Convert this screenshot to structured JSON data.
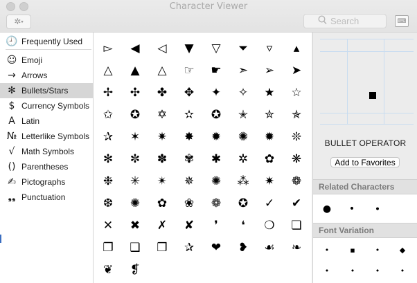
{
  "window": {
    "title": "Character Viewer"
  },
  "toolbar": {
    "action_glyph": "✲",
    "search_placeholder": "Search",
    "keyboard_glyph": "⌨"
  },
  "sidebar": {
    "items": [
      {
        "icon": "🕘",
        "icon_name": "clock-icon",
        "label": "Frequently Used"
      },
      {
        "icon": "☺",
        "icon_name": "smiley-icon",
        "label": "Emoji"
      },
      {
        "icon": "→",
        "icon_name": "arrow-right-icon",
        "label": "Arrows"
      },
      {
        "icon": "✻",
        "icon_name": "asterisk-star-icon",
        "label": "Bullets/Stars",
        "selected": true
      },
      {
        "icon": "$",
        "icon_name": "dollar-icon",
        "label": "Currency Symbols"
      },
      {
        "icon": "A",
        "icon_name": "latin-letter-icon",
        "label": "Latin"
      },
      {
        "icon": "№",
        "icon_name": "numero-icon",
        "label": "Letterlike Symbols"
      },
      {
        "icon": "√",
        "icon_name": "square-root-icon",
        "label": "Math Symbols"
      },
      {
        "icon": "()",
        "icon_name": "parentheses-icon",
        "label": "Parentheses"
      },
      {
        "icon": "✍",
        "icon_name": "writing-hand-icon",
        "label": "Pictographs"
      },
      {
        "icon": "❟❟",
        "icon_name": "comma-quote-icon",
        "label": "Punctuation"
      }
    ]
  },
  "grid": {
    "rows": [
      [
        "▻",
        "◀",
        "◁",
        "▼",
        "▽",
        "⏷",
        "▿",
        "▴"
      ],
      [
        "△",
        "▲",
        "△",
        "☞",
        "☛",
        "➣",
        "➢",
        "➤"
      ],
      [
        "✢",
        "✣",
        "✤",
        "✥",
        "✦",
        "✧",
        "★",
        "☆"
      ],
      [
        "✩",
        "✪",
        "✡",
        "✫",
        "✪",
        "✭",
        "✮",
        "✯"
      ],
      [
        "✰",
        "✶",
        "✷",
        "✸",
        "✹",
        "✺",
        "✹",
        "❊"
      ],
      [
        "✻",
        "✼",
        "✽",
        "✾",
        "✱",
        "✲",
        "✿",
        "❋"
      ],
      [
        "❉",
        "✳",
        "✴",
        "✵",
        "✺",
        "⁂",
        "✷",
        "❁"
      ],
      [
        "❆",
        "✺",
        "✿",
        "❀",
        "❁",
        "✪",
        "✓",
        "✔"
      ],
      [
        "✕",
        "✖",
        "✗",
        "✘",
        "❜",
        "❛",
        "❍",
        "❏"
      ],
      [
        "❐",
        "❑",
        "❒",
        "✰",
        "❤",
        "❥",
        "☙",
        "❧"
      ],
      [
        "❦",
        "❡"
      ]
    ]
  },
  "detail": {
    "char_name": "BULLET OPERATOR",
    "favorites_label": "Add to Favorites",
    "related_title": "Related Characters",
    "related": [
      "●",
      "•",
      "∙"
    ],
    "font_variation_title": "Font Variation",
    "variations": [
      "•",
      "▪",
      "•",
      "◆",
      "•",
      "•",
      "•",
      "•"
    ]
  }
}
